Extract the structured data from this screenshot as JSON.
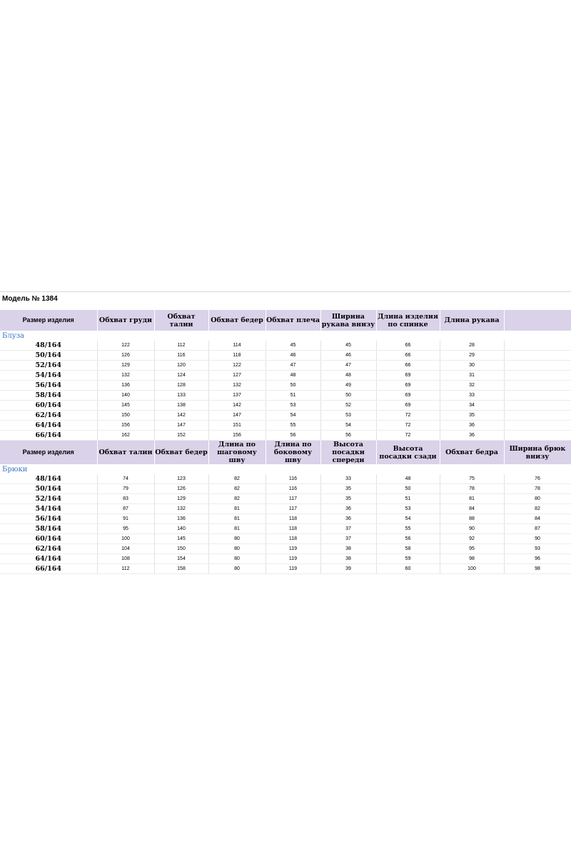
{
  "model_title": "Модель №  1384",
  "blouse": {
    "section_label": "Блуза",
    "headers": [
      "Размер изделия",
      "Обхват груди",
      "Обхват талии",
      "Обхват бедер",
      "Обхват плеча",
      "Ширина рукава внизу",
      "Длина изделия по спинке",
      "Длина рукава",
      ""
    ],
    "rows": [
      [
        "48/164",
        "122",
        "112",
        "114",
        "45",
        "45",
        "66",
        "28",
        ""
      ],
      [
        "50/164",
        "126",
        "116",
        "118",
        "46",
        "46",
        "66",
        "29",
        ""
      ],
      [
        "52/164",
        "129",
        "120",
        "122",
        "47",
        "47",
        "66",
        "30",
        ""
      ],
      [
        "54/164",
        "132",
        "124",
        "127",
        "48",
        "48",
        "69",
        "31",
        ""
      ],
      [
        "56/164",
        "136",
        "128",
        "132",
        "50",
        "49",
        "69",
        "32",
        ""
      ],
      [
        "58/164",
        "140",
        "133",
        "137",
        "51",
        "50",
        "69",
        "33",
        ""
      ],
      [
        "60/164",
        "145",
        "138",
        "142",
        "53",
        "52",
        "69",
        "34",
        ""
      ],
      [
        "62/164",
        "150",
        "142",
        "147",
        "54",
        "53",
        "72",
        "35",
        ""
      ],
      [
        "64/164",
        "156",
        "147",
        "151",
        "55",
        "54",
        "72",
        "36",
        ""
      ],
      [
        "66/164",
        "162",
        "152",
        "156",
        "56",
        "56",
        "72",
        "36",
        ""
      ]
    ]
  },
  "trousers": {
    "section_label": "Брюки",
    "headers": [
      "Размер изделия",
      "Обхват талии",
      "Обхват бедер",
      "Длина по шаговому шву",
      "Длина по боковому шву",
      "Высота посадки спереди",
      "Высота посадки сзади",
      "Обхват бедра",
      "Ширина брюк внизу"
    ],
    "rows": [
      [
        "48/164",
        "74",
        "123",
        "82",
        "116",
        "33",
        "48",
        "75",
        "76"
      ],
      [
        "50/164",
        "79",
        "126",
        "82",
        "116",
        "35",
        "50",
        "78",
        "78"
      ],
      [
        "52/164",
        "83",
        "129",
        "82",
        "117",
        "35",
        "51",
        "81",
        "80"
      ],
      [
        "54/164",
        "87",
        "132",
        "81",
        "117",
        "36",
        "53",
        "84",
        "82"
      ],
      [
        "56/164",
        "91",
        "136",
        "81",
        "118",
        "36",
        "54",
        "88",
        "84"
      ],
      [
        "58/164",
        "95",
        "140",
        "81",
        "118",
        "37",
        "55",
        "90",
        "87"
      ],
      [
        "60/164",
        "100",
        "145",
        "80",
        "118",
        "37",
        "56",
        "92",
        "90"
      ],
      [
        "62/164",
        "104",
        "150",
        "80",
        "119",
        "38",
        "58",
        "95",
        "93"
      ],
      [
        "64/164",
        "108",
        "154",
        "80",
        "119",
        "38",
        "59",
        "98",
        "96"
      ],
      [
        "66/164",
        "112",
        "158",
        "80",
        "119",
        "39",
        "60",
        "100",
        "98"
      ]
    ]
  }
}
